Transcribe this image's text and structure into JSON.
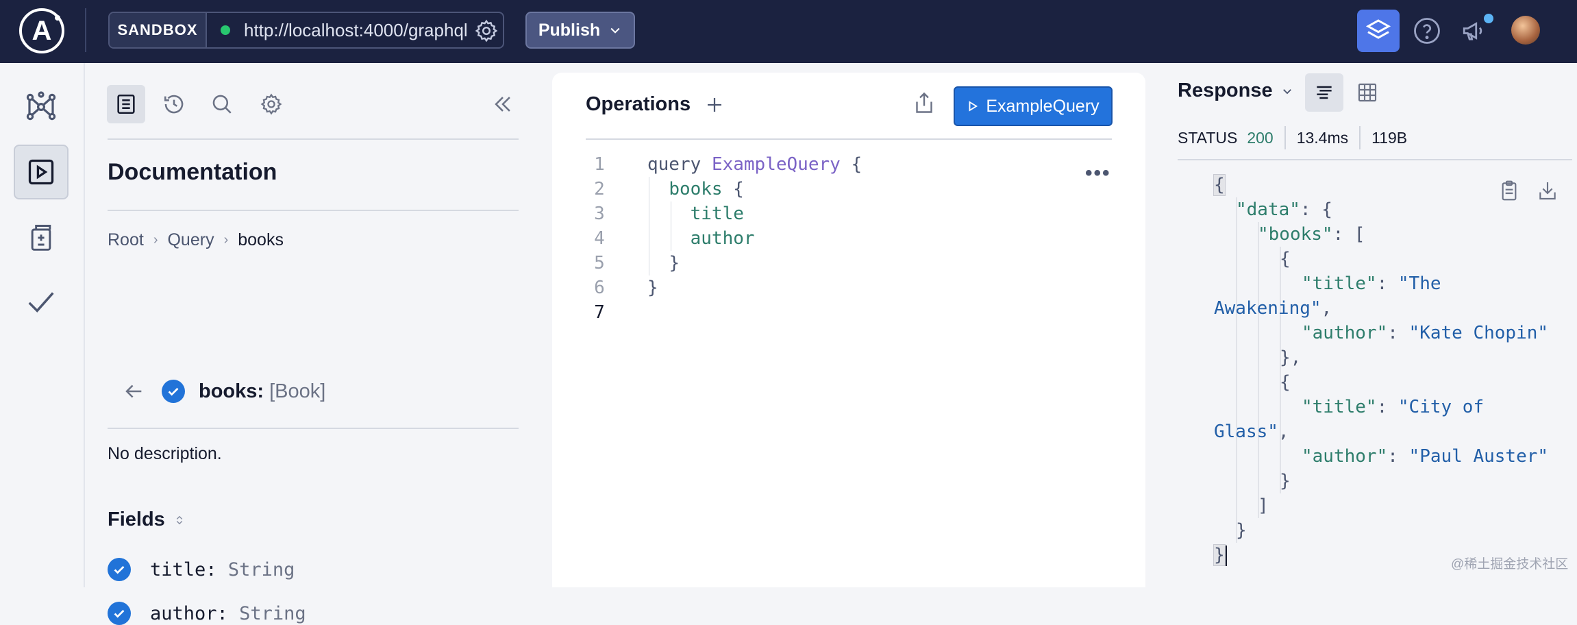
{
  "topbar": {
    "logo_letter": "A",
    "sandbox_label": "SANDBOX",
    "url": "http://localhost:4000/graphql",
    "publish_label": "Publish"
  },
  "docs": {
    "title": "Documentation",
    "breadcrumb": [
      "Root",
      "Query",
      "books"
    ],
    "field_name": "books:",
    "field_type": "[Book]",
    "description": "No description.",
    "fields_title": "Fields",
    "fields": [
      {
        "name": "title:",
        "type": "String"
      },
      {
        "name": "author:",
        "type": "String"
      }
    ]
  },
  "operations": {
    "title": "Operations",
    "run_label": "ExampleQuery",
    "line_numbers": [
      "1",
      "2",
      "3",
      "4",
      "5",
      "6",
      "7"
    ],
    "code": {
      "l1_kw": "query",
      "l1_name": "ExampleQuery",
      "l1_brace": "{",
      "l2_field": "books",
      "l2_brace": "{",
      "l3": "title",
      "l4": "author",
      "l5": "}",
      "l6": "}"
    }
  },
  "response": {
    "title": "Response",
    "status_label": "STATUS",
    "status_code": "200",
    "time": "13.4ms",
    "size": "119B",
    "json_lines": {
      "l1": "{",
      "l2_key": "\"data\"",
      "l2_rest": ": {",
      "l3_key": "\"books\"",
      "l3_rest": ": [",
      "l4": "{",
      "l5_key": "\"title\"",
      "l5_sep": ": ",
      "l5_val": "\"The",
      "l6_val": "Awakening\"",
      "l6_rest": ",",
      "l7_key": "\"author\"",
      "l7_sep": ": ",
      "l7_val": "\"Kate Chopin\"",
      "l8": "},",
      "l9": "{",
      "l10_key": "\"title\"",
      "l10_sep": ": ",
      "l10_val": "\"City of",
      "l11_val": "Glass\"",
      "l11_rest": ",",
      "l12_key": "\"author\"",
      "l12_sep": ": ",
      "l12_val": "\"Paul Auster\"",
      "l13": "}",
      "l14": "]",
      "l15": "}",
      "l16": "}"
    }
  },
  "watermark": "@稀土掘金技术社区",
  "colors": {
    "topbar": "#1b2240",
    "accent": "#2373dc",
    "status_ok": "#2d7d6b"
  }
}
